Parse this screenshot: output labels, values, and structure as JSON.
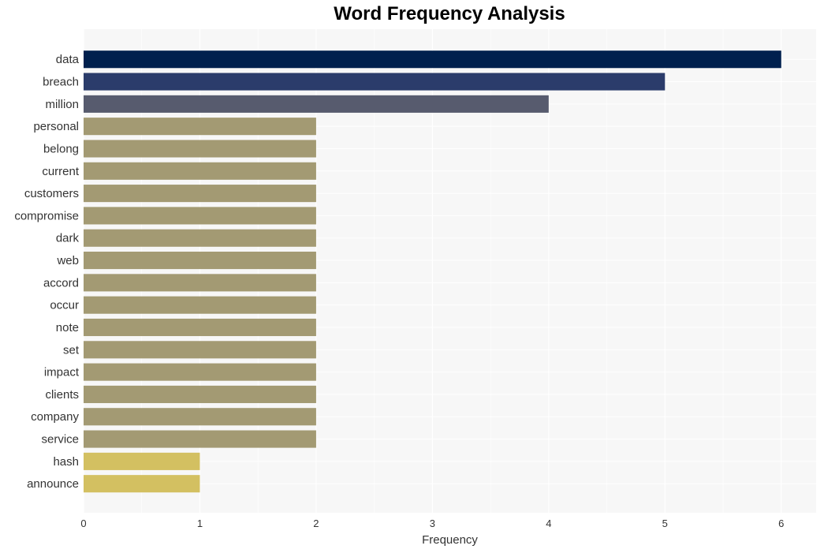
{
  "chart_data": {
    "type": "bar",
    "orientation": "horizontal",
    "title": "Word Frequency Analysis",
    "xlabel": "Frequency",
    "ylabel": "",
    "xlim": [
      0,
      6.3
    ],
    "xticks": [
      "0",
      "1",
      "2",
      "3",
      "4",
      "5",
      "6"
    ],
    "grid": true,
    "categories": [
      "data",
      "breach",
      "million",
      "personal",
      "belong",
      "current",
      "customers",
      "compromise",
      "dark",
      "web",
      "accord",
      "occur",
      "note",
      "set",
      "impact",
      "clients",
      "company",
      "service",
      "hash",
      "announce"
    ],
    "values": [
      6,
      5,
      4,
      2,
      2,
      2,
      2,
      2,
      2,
      2,
      2,
      2,
      2,
      2,
      2,
      2,
      2,
      2,
      1,
      1
    ],
    "colors": [
      "#00204e",
      "#2b3c6b",
      "#575b6e",
      "#a39a73",
      "#a39a73",
      "#a39a73",
      "#a39a73",
      "#a39a73",
      "#a39a73",
      "#a39a73",
      "#a39a73",
      "#a39a73",
      "#a39a73",
      "#a39a73",
      "#a39a73",
      "#a39a73",
      "#a39a73",
      "#a39a73",
      "#d3c061",
      "#d3c061"
    ]
  },
  "colors": {
    "plot_background": "#f7f7f7",
    "grid": "#ffffff"
  }
}
